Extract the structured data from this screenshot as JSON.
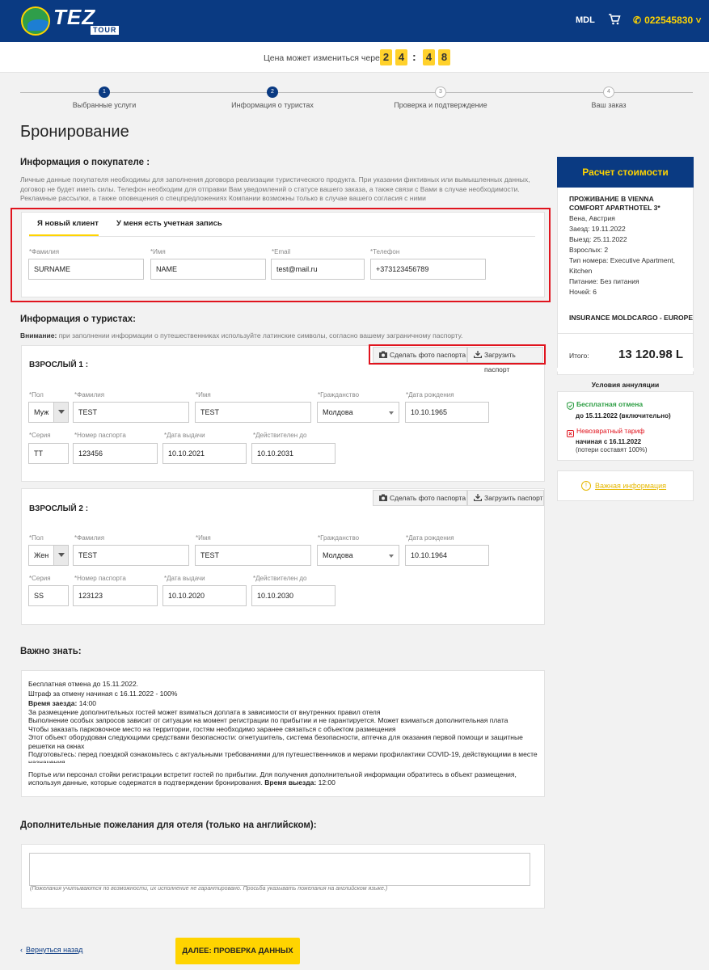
{
  "header": {
    "logo_main": "TEZ",
    "logo_sub": "TOUR",
    "currency": "MDL",
    "phone": "022545830"
  },
  "timer": {
    "label": "Цена может измениться через",
    "minutes": [
      "2",
      "4"
    ],
    "seconds": [
      "4",
      "8"
    ],
    "separator": ":"
  },
  "steps": [
    {
      "num": "1",
      "label": "Выбранные услуги"
    },
    {
      "num": "2",
      "label": "Информация о туристах"
    },
    {
      "num": "3",
      "label": "Проверка и подтверждение"
    },
    {
      "num": "4",
      "label": "Ваш заказ"
    }
  ],
  "page_title": "Бронирование",
  "buyer": {
    "title": "Информация о покупателе :",
    "description": "Личные данные покупателя необходимы для заполнения договора реализации туристического продукта. При указании фиктивных или вымышленных данных, договор не будет иметь силы. Телефон необходим для отправки Вам уведомлений о статусе вашего заказа, а также связи с Вами в случае необходимости. Рекламные рассылки, а также оповещения о спецпредложениях Компании возможны только в случае вашего согласия с ними",
    "tabs": [
      "Я новый клиент",
      "У меня есть учетная запись"
    ],
    "fields": [
      {
        "label": "*Фамилия",
        "value": "SURNAME"
      },
      {
        "label": "*Имя",
        "value": "NAME"
      },
      {
        "label": "*Email",
        "value": "test@mail.ru"
      },
      {
        "label": "*Телефон",
        "value": "+373123456789"
      }
    ]
  },
  "tourists": {
    "title": "Информация о туристах:",
    "note_bold": "Внимание:",
    "note": "при заполнении информации о путешественниках используйте латинские символы, согласно вашему заграничному паспорту.",
    "photo_btn": "Сделать фото паспорта",
    "upload_btn": "Загрузить паспорт",
    "labels": {
      "gender": "*Пол",
      "surname": "*Фамилия",
      "name": "*Имя",
      "citizenship": "*Гражданство",
      "birth": "*Дата рождения",
      "series": "*Серия",
      "passport": "*Номер паспорта",
      "issued": "*Дата выдачи",
      "valid": "*Действителен до"
    },
    "list": [
      {
        "title": "ВЗРОСЛЫЙ 1 :",
        "gender": "Муж",
        "surname": "TEST",
        "name": "TEST",
        "citizenship": "Молдова",
        "birth": "10.10.1965",
        "series": "TT",
        "passport": "123456",
        "issued": "10.10.2021",
        "valid": "10.10.2031"
      },
      {
        "title": "ВЗРОСЛЫЙ 2 :",
        "gender": "Жен",
        "surname": "TEST",
        "name": "TEST",
        "citizenship": "Молдова",
        "birth": "10.10.1964",
        "series": "SS",
        "passport": "123123",
        "issued": "10.10.2020",
        "valid": "10.10.2030"
      }
    ]
  },
  "important": {
    "title": "Важно знать:",
    "lines": [
      "Бесплатная отмена до 15.11.2022.",
      "Штраф за отмену начиная с 16.11.2022 - 100%"
    ],
    "checkin_label": "Время заезда:",
    "checkin_value": "14:00",
    "body": "За размещение дополнительных гостей может взиматься доплата в зависимости от внутренних правил отеля\nВыполнение особых запросов зависит от ситуации на момент регистрации по прибытии и не гарантируется. Может взиматься дополнительная плата\nЧтобы заказать парковочное место на территории, гостям необходимо заранее связаться с объектом размещения\nЭтот объект оборудован следующими средствами безопасности: огнетушитель, система безопасности, аптечка для оказания первой помощи и защитные решетки на окнах\nПодготовьтесь: перед поездкой ознакомьтесь с актуальными требованиями для путешественников и мерами профилактики COVID-19, действующими в месте назначения.",
    "reception": "Портье или персонал стойки регистрации встретит гостей по прибытии. Для получения дополнительной информации обратитесь в объект размещения, используя данные, которые содержатся в подтверждении бронирования.",
    "checkout_label": "Время выезда:",
    "checkout_value": "12:00"
  },
  "wishes": {
    "title": "Дополнительные пожелания для отеля (только на английском):",
    "hint": "(Пожелания учитываются по возможности, их исполнение не гарантировано. Просьба указывать пожелания на английском языке.)"
  },
  "footer": {
    "back": "Вернуться назад",
    "next": "ДАЛЕЕ: ПРОВЕРКА ДАННЫХ"
  },
  "sidebar": {
    "title": "Расчет стоимости",
    "hotel": "ПРОЖИВАНИЕ В VIENNA COMFORT APARTHOTEL 3*",
    "details": [
      "Вена, Австрия",
      "Заезд: 19.11.2022",
      "Выезд: 25.11.2022",
      "Взрослых: 2",
      "Тип номера: Executive Apartment, Kitchen",
      "Питание: Без питания",
      "Ночей: 6"
    ],
    "insurance": "INSURANCE MOLDCARGO - EUROPE",
    "total_label": "Итого:",
    "total_value": "13 120.98 L",
    "cancel_title": "Условия аннуляции",
    "free_cancel": "Бесплатная отмена",
    "free_until": "до 15.11.2022 (включительно)",
    "nonrefund": "Невозвратный тариф",
    "nonrefund_from": "начиная с 16.11.2022",
    "nonrefund_loss": "(потери составят 100%)",
    "important_info": "Важная информация",
    "colors": {
      "brand_blue": "#0a3a82",
      "accent_yellow": "#ffd400",
      "green": "#2e9e44",
      "red": "#e0141e"
    }
  }
}
